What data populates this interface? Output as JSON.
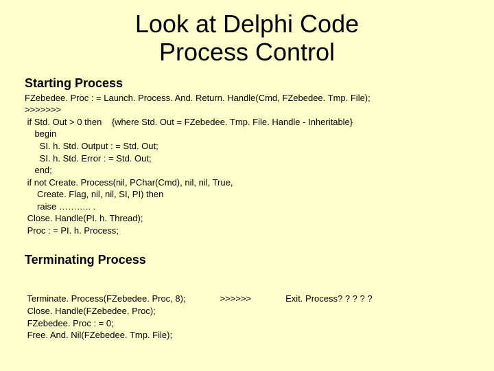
{
  "title_line1": "Look at Delphi Code",
  "title_line2": "Process Control",
  "starting": {
    "heading": "Starting Process",
    "code": "FZebedee. Proc : = Launch. Process. And. Return. Handle(Cmd, FZebedee. Tmp. File);\n>>>>>>>\n if Std. Out > 0 then    {where Std. Out = FZebedee. Tmp. File. Handle - Inheritable}\n    begin\n      SI. h. Std. Output : = Std. Out;\n      SI. h. Std. Error : = Std. Out;\n    end;\n if not Create. Process(nil, PChar(Cmd), nil, nil, True,\n     Create. Flag, nil, nil, SI, PI) then\n     raise ……….. .\n Close. Handle(PI. h. Thread);\n Proc : = PI. h. Process;"
  },
  "terminating": {
    "heading": "Terminating Process",
    "col1": " Terminate. Process(FZebedee. Proc, 8);\n Close. Handle(FZebedee. Proc);\n FZebedee. Proc : = 0;\n Free. And. Nil(FZebedee. Tmp. File);",
    "col2": ">>>>>>",
    "col3": "Exit. Process? ? ? ? ?"
  }
}
